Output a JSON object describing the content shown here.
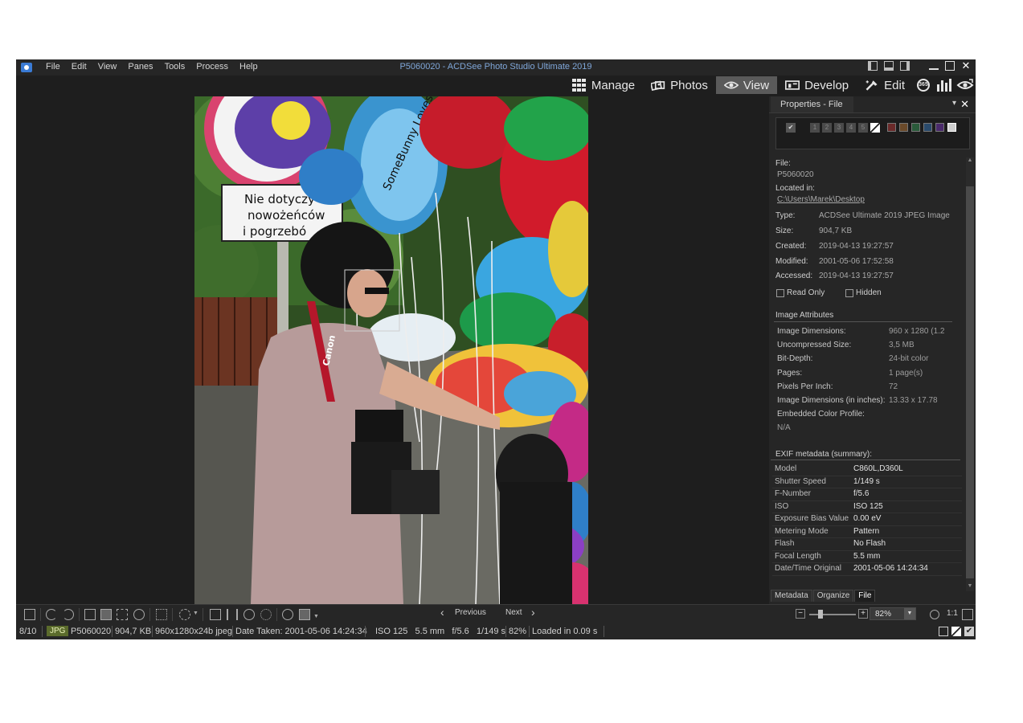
{
  "window": {
    "title": "P5060020 - ACDSee Photo Studio Ultimate 2019",
    "close_glyph": "✕"
  },
  "menu": [
    "File",
    "Edit",
    "View",
    "Panes",
    "Tools",
    "Process",
    "Help"
  ],
  "modes": [
    {
      "label": "Manage",
      "icon": "grid-icon"
    },
    {
      "label": "Photos",
      "icon": "photos-icon"
    },
    {
      "label": "View",
      "icon": "eye-icon",
      "active": true
    },
    {
      "label": "Develop",
      "icon": "develop-icon"
    },
    {
      "label": "Edit",
      "icon": "brush-icon"
    }
  ],
  "mode_extra": {
    "badge365": "365"
  },
  "properties": {
    "title": "Properties - File",
    "rating_numbers": [
      "1",
      "2",
      "3",
      "4",
      "5"
    ],
    "file_label": "File:",
    "file_value": "P5060020",
    "location_label": "Located in:",
    "location_value": "C:\\Users\\Marek\\Desktop",
    "fields": [
      {
        "label": "Type:",
        "value": "ACDSee Ultimate 2019 JPEG Image"
      },
      {
        "label": "Size:",
        "value": "904,7 KB"
      },
      {
        "label": "Created:",
        "value": "2019-04-13 19:27:57"
      },
      {
        "label": "Modified:",
        "value": "2001-05-06 17:52:58"
      },
      {
        "label": "Accessed:",
        "value": "2019-04-13 19:27:57"
      }
    ],
    "read_only_label": "Read Only",
    "hidden_label": "Hidden",
    "image_attributes_title": "Image Attributes",
    "attributes": [
      {
        "label": "Image Dimensions:",
        "value": "960 x 1280 (1.2"
      },
      {
        "label": "Uncompressed Size:",
        "value": "3,5 MB"
      },
      {
        "label": "Bit-Depth:",
        "value": "24-bit color"
      },
      {
        "label": "Pages:",
        "value": "1 page(s)"
      },
      {
        "label": "Pixels Per Inch:",
        "value": "72"
      },
      {
        "label": "Image Dimensions (in inches):",
        "value": "13.33 x 17.78"
      }
    ],
    "color_profile_label": "Embedded Color Profile:",
    "color_profile_value": "N/A",
    "exif_title": "EXIF metadata (summary):",
    "exif": [
      {
        "key": "Model",
        "value": "C860L,D360L"
      },
      {
        "key": "Shutter Speed",
        "value": "1/149 s"
      },
      {
        "key": "F-Number",
        "value": "f/5.6"
      },
      {
        "key": "ISO",
        "value": "ISO 125"
      },
      {
        "key": "Exposure Bias Value",
        "value": "0.00 eV"
      },
      {
        "key": "Metering Mode",
        "value": "Pattern"
      },
      {
        "key": "Flash",
        "value": "No Flash"
      },
      {
        "key": "Focal Length",
        "value": "5.5 mm"
      },
      {
        "key": "Date/Time Original",
        "value": "2001-05-06 14:24:34"
      }
    ],
    "tabs": [
      "Metadata",
      "Organize",
      "File"
    ],
    "active_tab": "File"
  },
  "photo_signs": {
    "sign_line1": "Nie  dotyczy",
    "sign_line2": "nowożeńców",
    "sign_line3": "i  pogrzebó",
    "balloon_text": "SomeBunny Loves you",
    "strap_text": "Canon"
  },
  "toolbar": {
    "previous": "Previous",
    "next": "Next",
    "zoom_value": "82%",
    "zoom_1to1": "1:1"
  },
  "status": {
    "index": "8/10",
    "format": "JPG",
    "filename": "P5060020",
    "size": "904,7 KB",
    "dims": "960x1280x24b jpeg",
    "date_taken": "Date Taken: 2001-05-06 14:24:34",
    "exposure": "ISO 125   5.5 mm   f/5.6   1/149 s",
    "zoom": "82%",
    "load_time": "Loaded in 0.09 s"
  },
  "colors": {
    "app_bg": "#1e1e1e",
    "panel_bg": "#262626",
    "title_blue": "#7fa6d8",
    "active_mode": "#5a5a5a",
    "jpg_badge": "#5b6b2c"
  }
}
